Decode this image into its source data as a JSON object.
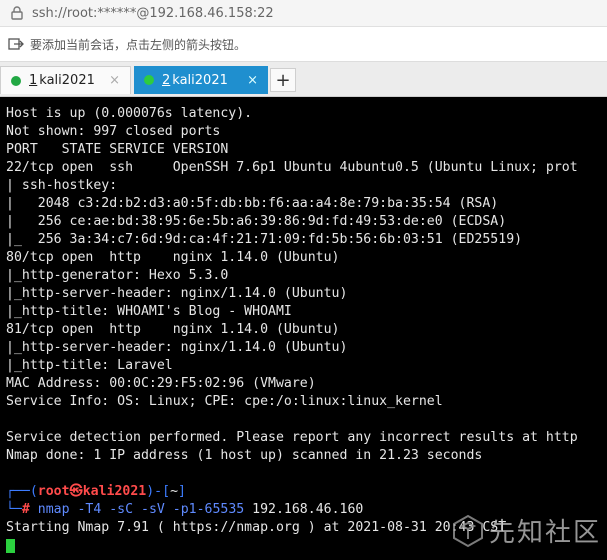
{
  "window": {
    "title": "ssh://root:******@192.168.46.158:22"
  },
  "hint": {
    "text": "要添加当前会话，点击左侧的箭头按钮。"
  },
  "tabs": [
    {
      "number": "1",
      "label": " kali2021",
      "active": false
    },
    {
      "number": "2",
      "label": " kali2021",
      "active": true
    }
  ],
  "new_tab_label": "+",
  "close_label": "×",
  "terminal": {
    "lines": [
      "Host is up (0.000076s latency).",
      "Not shown: 997 closed ports",
      "PORT   STATE SERVICE VERSION",
      "22/tcp open  ssh     OpenSSH 7.6p1 Ubuntu 4ubuntu0.5 (Ubuntu Linux; prot",
      "| ssh-hostkey:",
      "|   2048 c3:2d:b2:d3:a0:5f:db:bb:f6:aa:a4:8e:79:ba:35:54 (RSA)",
      "|   256 ce:ae:bd:38:95:6e:5b:a6:39:86:9d:fd:49:53:de:e0 (ECDSA)",
      "|_  256 3a:34:c7:6d:9d:ca:4f:21:71:09:fd:5b:56:6b:03:51 (ED25519)",
      "80/tcp open  http    nginx 1.14.0 (Ubuntu)",
      "|_http-generator: Hexo 5.3.0",
      "|_http-server-header: nginx/1.14.0 (Ubuntu)",
      "|_http-title: WHOAMI's Blog - WHOAMI",
      "81/tcp open  http    nginx 1.14.0 (Ubuntu)",
      "|_http-server-header: nginx/1.14.0 (Ubuntu)",
      "|_http-title: Laravel",
      "MAC Address: 00:0C:29:F5:02:96 (VMware)",
      "Service Info: OS: Linux; CPE: cpe:/o:linux:linux_kernel",
      "",
      "Service detection performed. Please report any incorrect results at http",
      "Nmap done: 1 IP address (1 host up) scanned in 21.23 seconds"
    ],
    "prompt": {
      "open": "┌──(",
      "user": "root㉿kali2021",
      "mid": ")-[",
      "dir": "~",
      "close": "]",
      "second": "└─",
      "hash": "# ",
      "command": "nmap",
      "args": " -T4 -sC -sV -p1-65535 ",
      "target": "192.168.46.160"
    },
    "after_line": "Starting Nmap 7.91 ( https://nmap.org ) at 2021-08-31 20:43 CST"
  },
  "watermark": {
    "text": "先知社区"
  }
}
